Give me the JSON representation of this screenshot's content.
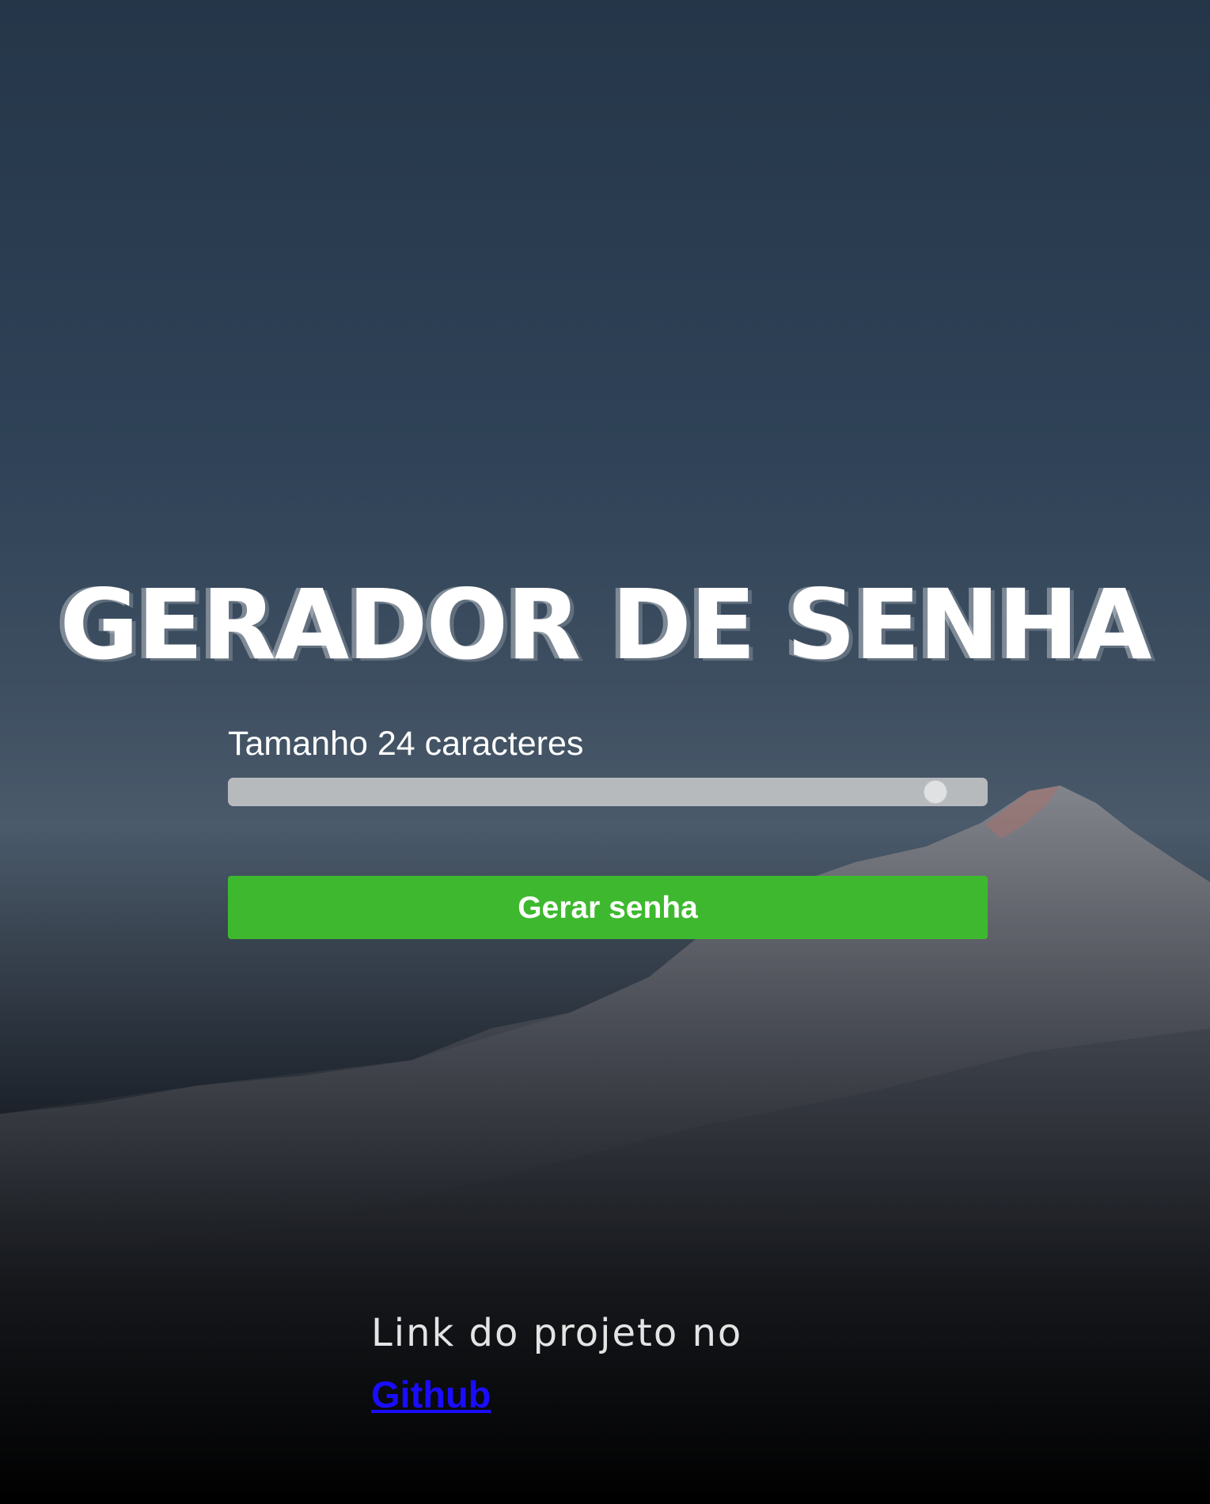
{
  "title": "GERADOR DE SENHA",
  "size_control": {
    "label": "Tamanho 24 caracteres",
    "value": 24,
    "min": 6,
    "max": 25
  },
  "generate_button": {
    "label": "Gerar senha"
  },
  "footer": {
    "text": "Link do projeto no",
    "link_label": "Github"
  },
  "colors": {
    "button": "#3eb92f",
    "link": "#1a0dff",
    "track": "#b7babd"
  }
}
